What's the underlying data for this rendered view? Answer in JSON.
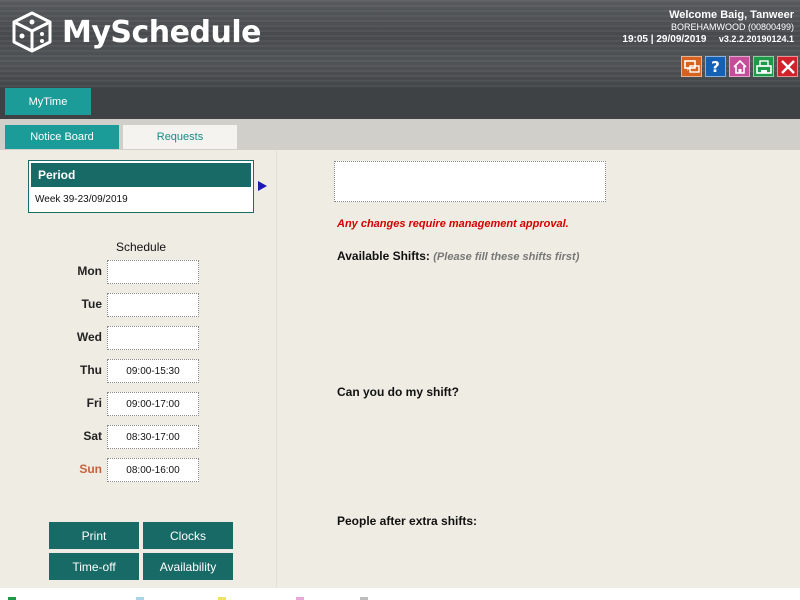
{
  "app": {
    "brand": "MySchedule",
    "welcome": "Welcome Baig, Tanweer",
    "branch": "BOREHAMWOOD (00800499)",
    "datetime": "19:05 | 29/09/2019",
    "version": "v3.2.2.20190124.1"
  },
  "toolbar": {
    "messages": "messages-icon",
    "help": "?",
    "home": "home-icon",
    "print": "print-icon",
    "close": "close-icon",
    "colors": {
      "messages": "#d5621f",
      "help": "#1460b5",
      "home": "#c54d9a",
      "print": "#1d9a47",
      "close": "#d1222b"
    }
  },
  "nav": {
    "main_tab": "MyTime",
    "sub_tabs": [
      "Notice Board",
      "Requests"
    ]
  },
  "period": {
    "header": "Period",
    "value": "Week 39-23/09/2019"
  },
  "schedule": {
    "title": "Schedule",
    "days": [
      {
        "day": "Mon",
        "time": ""
      },
      {
        "day": "Tue",
        "time": ""
      },
      {
        "day": "Wed",
        "time": ""
      },
      {
        "day": "Thu",
        "time": "09:00-15:30"
      },
      {
        "day": "Fri",
        "time": "09:00-17:00"
      },
      {
        "day": "Sat",
        "time": "08:30-17:00"
      },
      {
        "day": "Sun",
        "time": "08:00-16:00"
      }
    ]
  },
  "buttons": {
    "print": "Print",
    "clocks": "Clocks",
    "timeoff": "Time-off",
    "availability": "Availability"
  },
  "notice": {
    "message_value": "",
    "warning": "Any changes require management approval.",
    "available_label": "Available Shifts:",
    "available_hint": "(Please fill these shifts first)",
    "swap_label": "Can you do my shift?",
    "extra_label": "People after extra shifts:"
  },
  "colors": {
    "teal": "#1b9c98",
    "teal_dark": "#176a66",
    "warning": "#d40000",
    "sunday": "#c5623e"
  }
}
